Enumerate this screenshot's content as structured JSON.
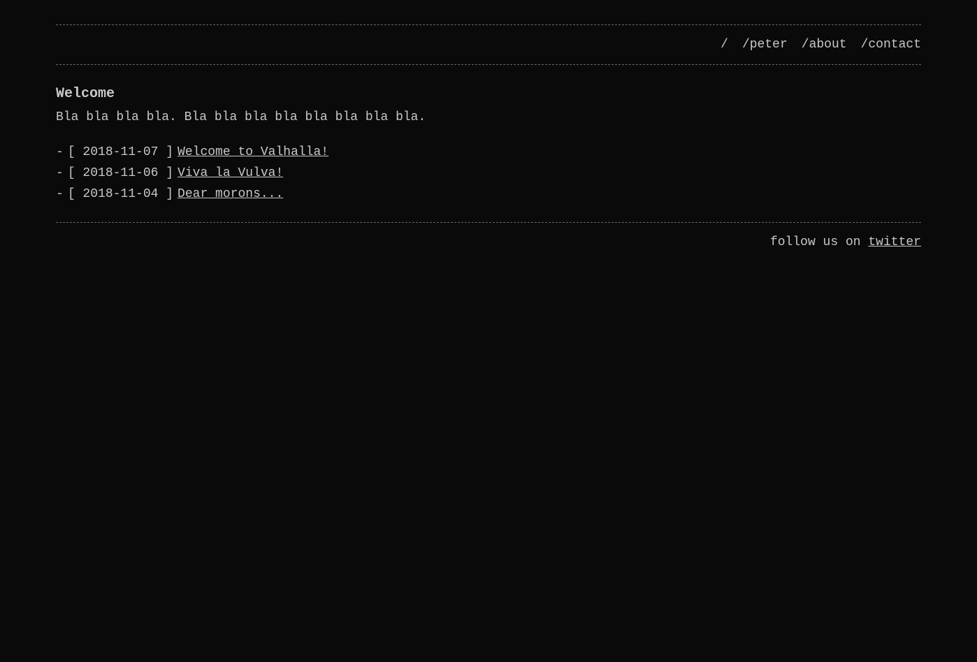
{
  "header": {
    "nav_separator": "/",
    "nav_links": [
      {
        "label": "/peter",
        "href": "#"
      },
      {
        "label": "/about",
        "href": "#"
      },
      {
        "label": "/contact",
        "href": "#"
      }
    ]
  },
  "main": {
    "welcome_heading": "Welcome",
    "welcome_text": "Bla bla bla bla. Bla bla bla bla bla bla bla bla.",
    "posts": [
      {
        "bullet": "-",
        "date": "[ 2018-11-07 ]",
        "title": "Welcome to Valhalla!",
        "href": "#"
      },
      {
        "bullet": "-",
        "date": "[ 2018-11-06 ]",
        "title": "Viva la Vulva!",
        "href": "#"
      },
      {
        "bullet": "-",
        "date": "[ 2018-11-04 ]",
        "title": "Dear morons...",
        "href": "#"
      }
    ]
  },
  "footer": {
    "text": "follow us on ",
    "link_label": "twitter",
    "link_href": "#"
  }
}
